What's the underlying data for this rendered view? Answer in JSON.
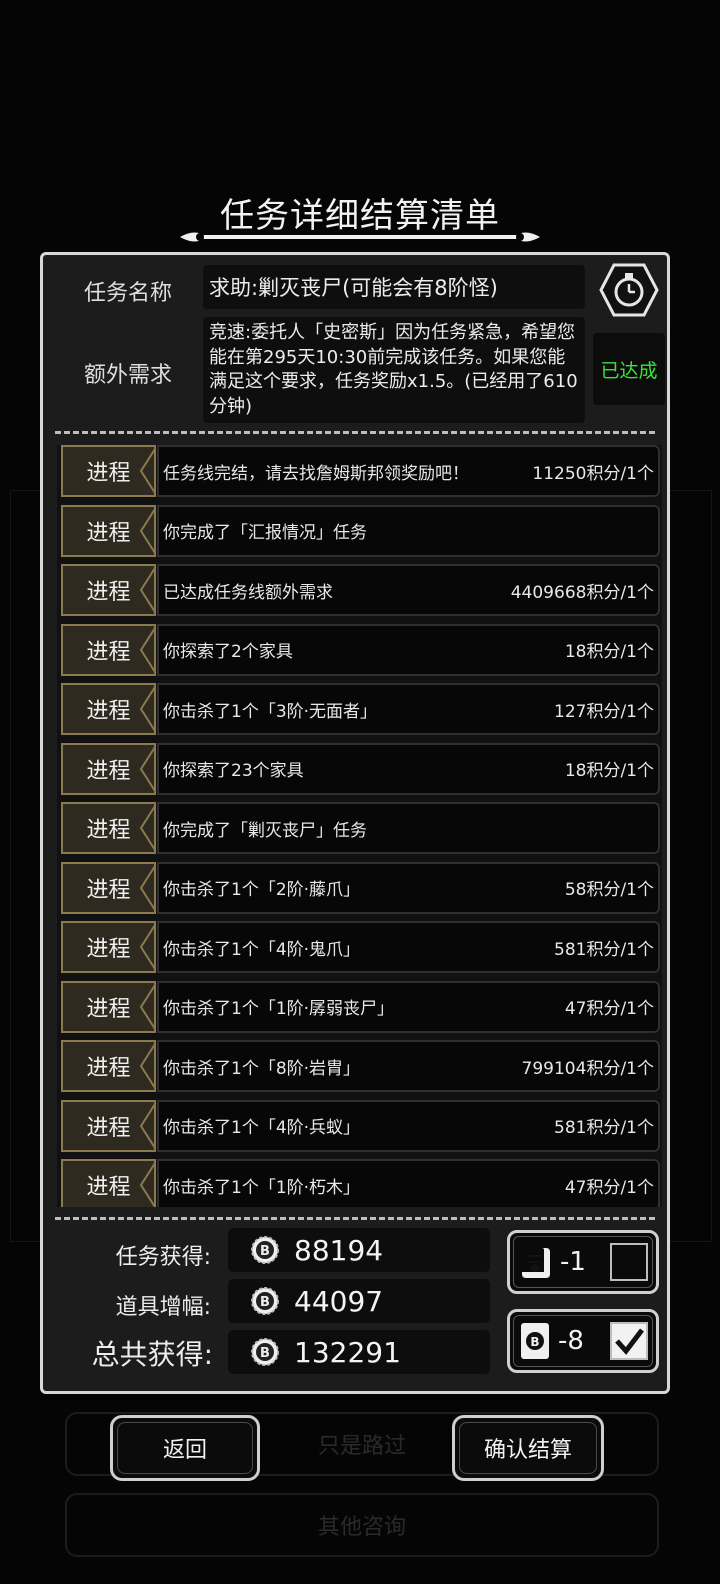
{
  "page_title": "任务详细结算清单",
  "task": {
    "name_label": "任务名称",
    "name_value": "求助:剿灭丧尸(可能会有8阶怪)",
    "extra_label": "额外需求",
    "extra_value": "竞速:委托人「史密斯」因为任务紧急，希望您能在第295天10:30前完成该任务。如果您能满足这个要求，任务奖励x1.5。(已经用了610分钟)",
    "extra_status": "已达成"
  },
  "progress": {
    "tag_label": "进程",
    "rows": [
      {
        "desc": "任务线完结，请去找詹姆斯邦领奖励吧！",
        "score": "11250积分/1个"
      },
      {
        "desc": "你完成了「汇报情况」任务",
        "score": ""
      },
      {
        "desc": "已达成任务线额外需求",
        "score": "4409668积分/1个"
      },
      {
        "desc": "你探索了2个家具",
        "score": "18积分/1个"
      },
      {
        "desc": "你击杀了1个「3阶·无面者」",
        "score": "127积分/1个"
      },
      {
        "desc": "你探索了23个家具",
        "score": "18积分/1个"
      },
      {
        "desc": "你完成了「剿灭丧尸」任务",
        "score": ""
      },
      {
        "desc": "你击杀了1个「2阶·藤爪」",
        "score": "58积分/1个"
      },
      {
        "desc": "你击杀了1个「4阶·鬼爪」",
        "score": "581积分/1个"
      },
      {
        "desc": "你击杀了1个「1阶·孱弱丧尸」",
        "score": "47积分/1个"
      },
      {
        "desc": "你击杀了1个「8阶·岩胄」",
        "score": "799104积分/1个"
      },
      {
        "desc": "你击杀了1个「4阶·兵蚁」",
        "score": "581积分/1个"
      },
      {
        "desc": "你击杀了1个「1阶·朽木」",
        "score": "47积分/1个"
      }
    ]
  },
  "summary": {
    "task_label": "任务获得:",
    "task_value": "88194",
    "item_label": "道具增幅:",
    "item_value": "44097",
    "total_label": "总共获得:",
    "total_value": "132291"
  },
  "items": {
    "scroll_count": "-1",
    "scroll_checked": false,
    "card_count": "-8",
    "card_checked": true
  },
  "actions": {
    "back_label": "返回",
    "confirm_label": "确认结算"
  },
  "background": {
    "button_pass": "只是路过",
    "button_consult": "其他咨询"
  },
  "colors": {
    "status_green": "#3ee03e",
    "tag_gold": "#8a7a4e",
    "panel_bg": "#1c1c1c"
  }
}
